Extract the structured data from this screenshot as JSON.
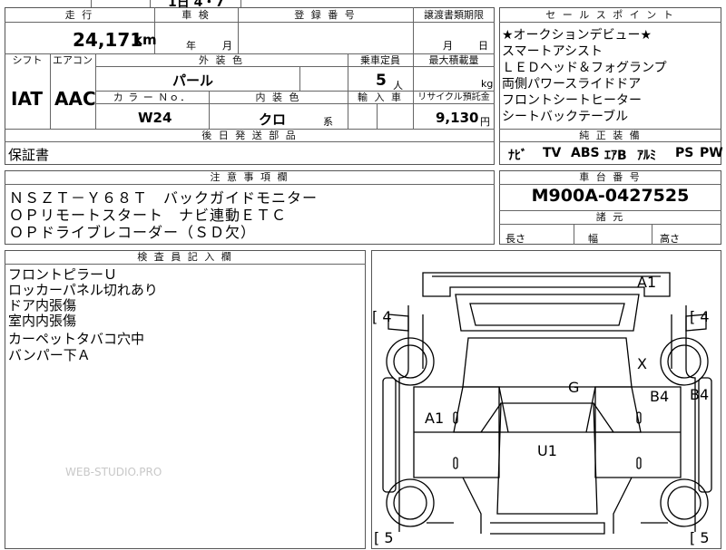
{
  "top_strip": "1日 4・7",
  "mileage": {
    "header": "走 行",
    "value": "24,171",
    "unit": "km"
  },
  "shaken": {
    "header": "車 検",
    "year_label": "年",
    "month_label": "月"
  },
  "registration": {
    "header": "登 録 番 号"
  },
  "transfer": {
    "header": "譲渡書類期限",
    "month_label": "月",
    "day_label": "日"
  },
  "shift": {
    "header": "シフト",
    "value": "IAT"
  },
  "aircon": {
    "header": "エアコン",
    "value": "AAC"
  },
  "exterior": {
    "header": "外 装 色",
    "value": "パール"
  },
  "capacity": {
    "header": "乗車定員",
    "value": "5",
    "unit": "人"
  },
  "max_load": {
    "header": "最大積載量",
    "unit": "kg"
  },
  "color_no": {
    "header": "カ ラ ー Ｎｏ．",
    "value": "W24"
  },
  "interior": {
    "header": "内 装 色",
    "value": "クロ",
    "suffix": "系"
  },
  "import": {
    "header": "輸 入 車"
  },
  "recycle": {
    "header": "リサイクル預託金",
    "value": "9,130",
    "unit": "円"
  },
  "later_parts": {
    "header": "後 日 発 送 部 品",
    "value": "保証書"
  },
  "notes": {
    "header": "注 意 事 項 欄",
    "lines": [
      "ＮＳＺＴ－Ｙ６８Ｔ　バックガイドモニター",
      "ＯＰリモートスタート　ナビ連動ＥＴＣ",
      "ＯＰドライブレコーダー（ＳＤ欠）"
    ]
  },
  "inspector": {
    "header": "検 査 員 記 入 欄",
    "lines": [
      "フロントピラーＵ",
      "ロッカーパネル切れあり",
      "ドア内張傷",
      "室内内張傷",
      "カーペットタバコ穴中",
      "バンパー下Ａ"
    ]
  },
  "sales_points": {
    "header": "セ ー ル ス ポ イ ン ト",
    "lines": [
      "★オークションデビュー★",
      "スマートアシスト",
      "ＬＥＤヘッド＆フォグランプ",
      "両側パワースライドドア",
      "フロントシートヒーター",
      "シートバックテーブル"
    ]
  },
  "equipment": {
    "header": "純 正 装 備",
    "items": [
      "ﾅﾋﾞ",
      "TV",
      "ABS",
      "ｴｱB",
      "ｱﾙﾐ",
      "PS",
      "PW"
    ]
  },
  "chassis": {
    "header": "車 台 番 号",
    "value": "M900A-0427525"
  },
  "specs": {
    "header": "諸 元",
    "length": "長さ",
    "width": "幅",
    "height": "高さ"
  },
  "diagram_marks": {
    "front_bumper": "A1",
    "left_front": "[ 4",
    "right_front": "[ 4",
    "right_rear": "[ 5",
    "left_rear": "[ 5",
    "right_panel_x": "X",
    "roof": "G",
    "right_door": "B4",
    "right_step": "B4",
    "left_door": "A1",
    "floor": "U1"
  },
  "watermark": "WEB-STUDIO.PRO"
}
